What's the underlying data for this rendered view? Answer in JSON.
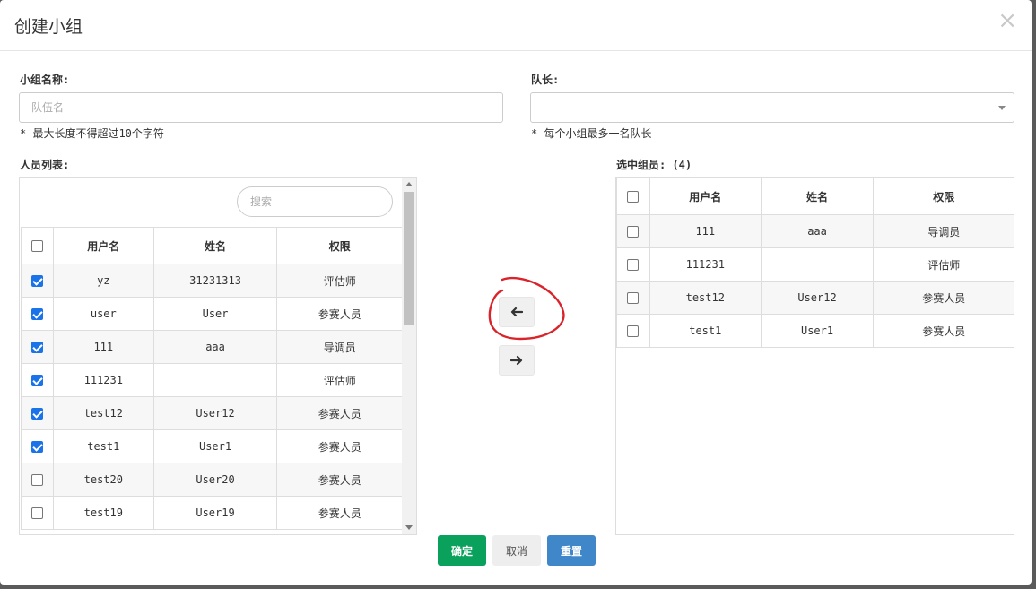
{
  "dialog": {
    "title": "创建小组",
    "close_glyph": "×"
  },
  "form": {
    "name_label": "小组名称:",
    "name_placeholder": "队伍名",
    "name_hint": "* 最大长度不得超过10个字符",
    "leader_label": "队长:",
    "leader_value": "",
    "leader_hint": "* 每个小组最多一名队长"
  },
  "left_panel": {
    "title": "人员列表:",
    "search_placeholder": "搜索",
    "columns": [
      "用户名",
      "姓名",
      "权限"
    ],
    "rows": [
      {
        "checked": true,
        "username": "yz",
        "name": "31231313",
        "role": "评估师"
      },
      {
        "checked": true,
        "username": "user",
        "name": "User",
        "role": "参赛人员"
      },
      {
        "checked": true,
        "username": "111",
        "name": "aaa",
        "role": "导调员"
      },
      {
        "checked": true,
        "username": "111231",
        "name": "",
        "role": "评估师"
      },
      {
        "checked": true,
        "username": "test12",
        "name": "User12",
        "role": "参赛人员"
      },
      {
        "checked": true,
        "username": "test1",
        "name": "User1",
        "role": "参赛人员"
      },
      {
        "checked": false,
        "username": "test20",
        "name": "User20",
        "role": "参赛人员"
      },
      {
        "checked": false,
        "username": "test19",
        "name": "User19",
        "role": "参赛人员"
      }
    ]
  },
  "right_panel": {
    "title": "选中组员: (4)",
    "columns": [
      "用户名",
      "姓名",
      "权限"
    ],
    "rows": [
      {
        "checked": false,
        "username": "111",
        "name": "aaa",
        "role": "导调员"
      },
      {
        "checked": false,
        "username": "111231",
        "name": "",
        "role": "评估师"
      },
      {
        "checked": false,
        "username": "test12",
        "name": "User12",
        "role": "参赛人员"
      },
      {
        "checked": false,
        "username": "test1",
        "name": "User1",
        "role": "参赛人员"
      }
    ]
  },
  "transfer": {
    "move_left_icon": "arrow-left-icon",
    "move_right_icon": "arrow-right-icon"
  },
  "footer": {
    "confirm_label": "确定",
    "cancel_label": "取消",
    "reset_label": "重置"
  },
  "colors": {
    "confirm": "#0aa15c",
    "reset": "#3f87c9",
    "checkbox": "#1a73e8",
    "annotation": "#d9242b"
  }
}
